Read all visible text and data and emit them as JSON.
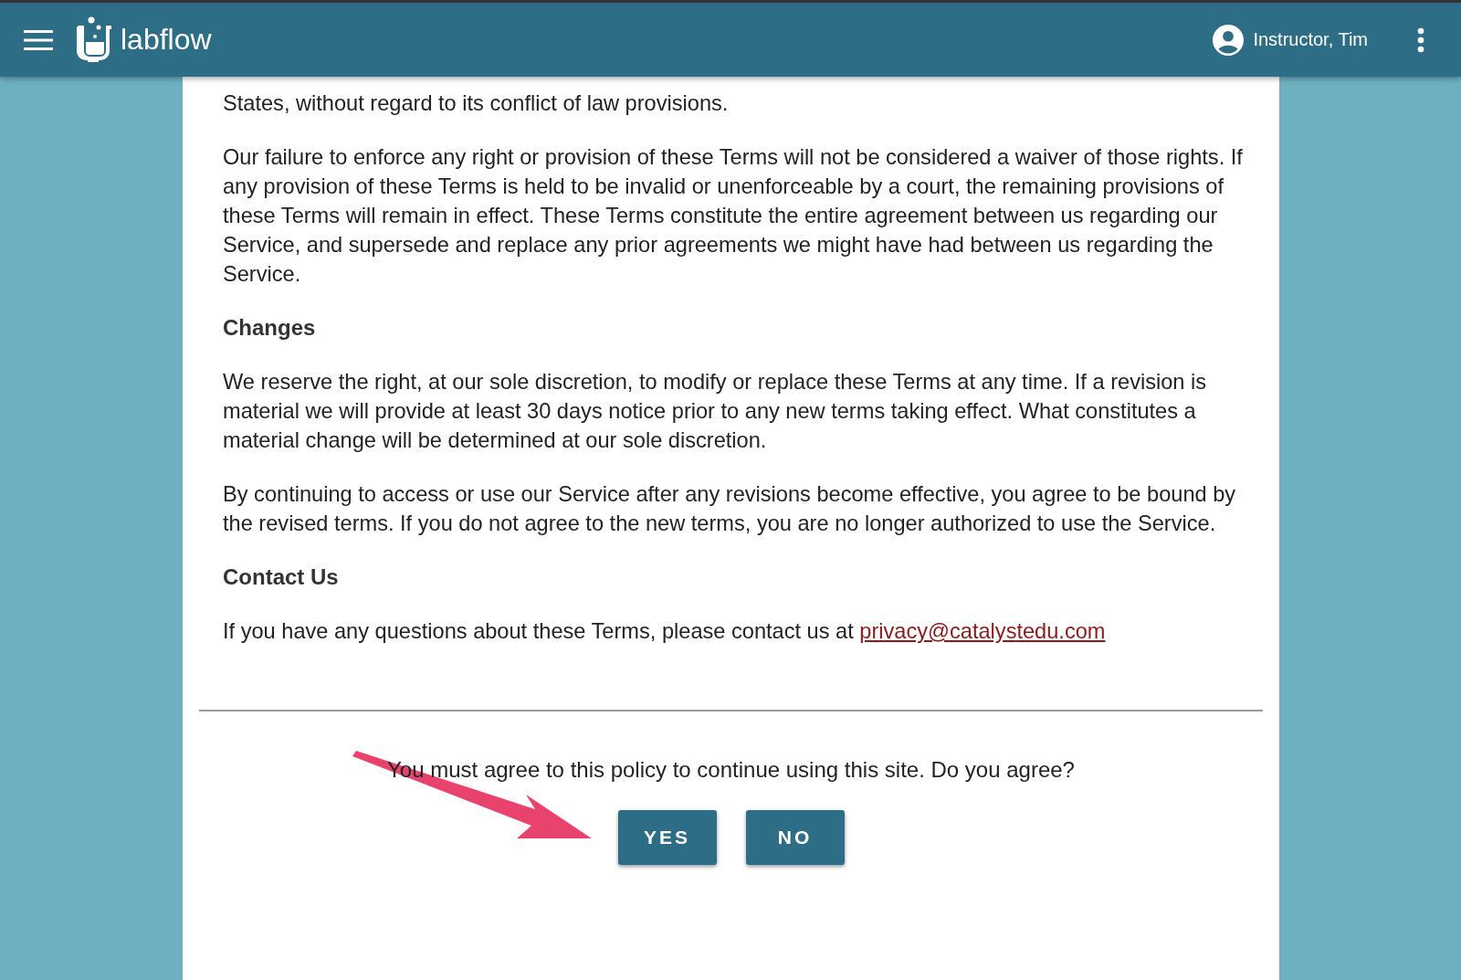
{
  "header": {
    "brand": "labflow",
    "user": "Instructor, Tim"
  },
  "sections": [
    {
      "kind": "paragraph",
      "text": "States, without regard to its conflict of law provisions."
    },
    {
      "kind": "paragraph",
      "text": "Our failure to enforce any right or provision of these Terms will not be considered a waiver of those rights. If any provision of these Terms is held to be invalid or unenforceable by a court, the remaining provisions of these Terms will remain in effect. These Terms constitute the entire agreement between us regarding our Service, and supersede and replace any prior agreements we might have had between us regarding the Service."
    },
    {
      "kind": "heading",
      "text": "Changes"
    },
    {
      "kind": "paragraph",
      "text": "We reserve the right, at our sole discretion, to modify or replace these Terms at any time. If a revision is material we will provide at least 30 days notice prior to any new terms taking effect. What constitutes a material change will be determined at our sole discretion."
    },
    {
      "kind": "paragraph",
      "text": "By continuing to access or use our Service after any revisions become effective, you agree to be bound by the revised terms. If you do not agree to the new terms, you are no longer authorized to use the Service."
    },
    {
      "kind": "heading",
      "text": "Contact Us"
    },
    {
      "kind": "contact",
      "text": "If you have any questions about these Terms, please contact us at",
      "link": "privacy@catalystedu.com"
    }
  ],
  "agree": {
    "prompt": "You must agree to this policy to continue using this site. Do you agree?",
    "buttons": [
      "YES",
      "NO"
    ]
  }
}
